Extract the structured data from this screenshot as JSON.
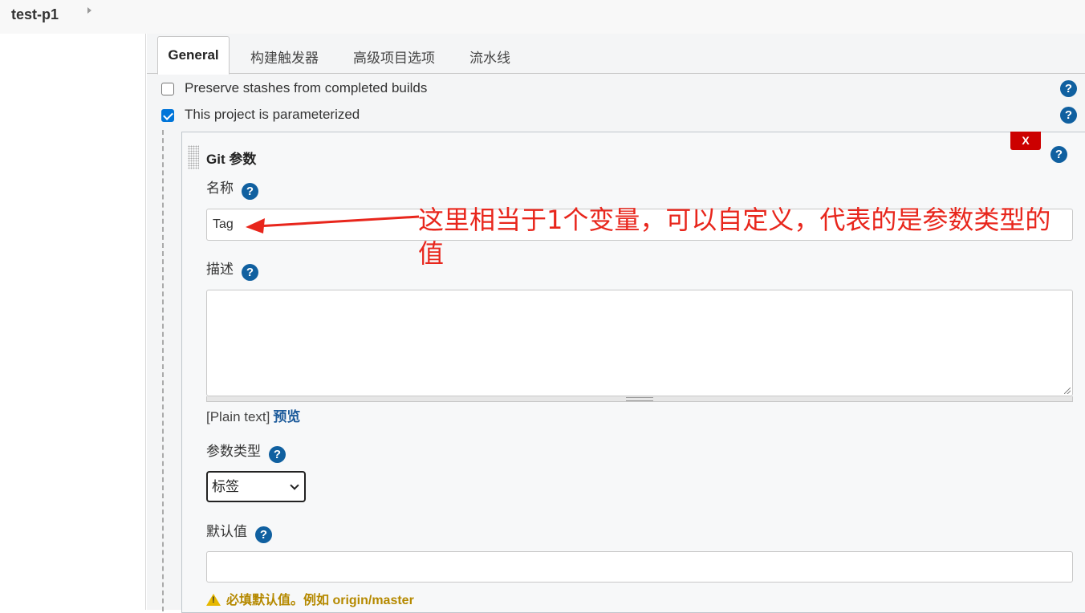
{
  "breadcrumb": {
    "project": "test-p1"
  },
  "tabs": [
    "General",
    "构建触发器",
    "高级项目选项",
    "流水线"
  ],
  "options": [
    {
      "label": "Preserve stashes from completed builds",
      "checked": false
    },
    {
      "label": "This project is parameterized",
      "checked": true
    }
  ],
  "help_glyph": "?",
  "param": {
    "title": "Git 参数",
    "delete_label": "X",
    "name_label": "名称",
    "name_value": "Tag",
    "description_label": "描述",
    "description_value": "",
    "markup_plain": "[Plain text]",
    "markup_preview": "预览",
    "type_label": "参数类型",
    "type_selected": "标签",
    "default_label": "默认值",
    "default_value": "",
    "default_warning": "必填默认值。例如 origin/master"
  },
  "annotation": {
    "text": "这里相当于1个变量，可以自定义，代表的是参数类型的值",
    "color": "#e8261c"
  }
}
